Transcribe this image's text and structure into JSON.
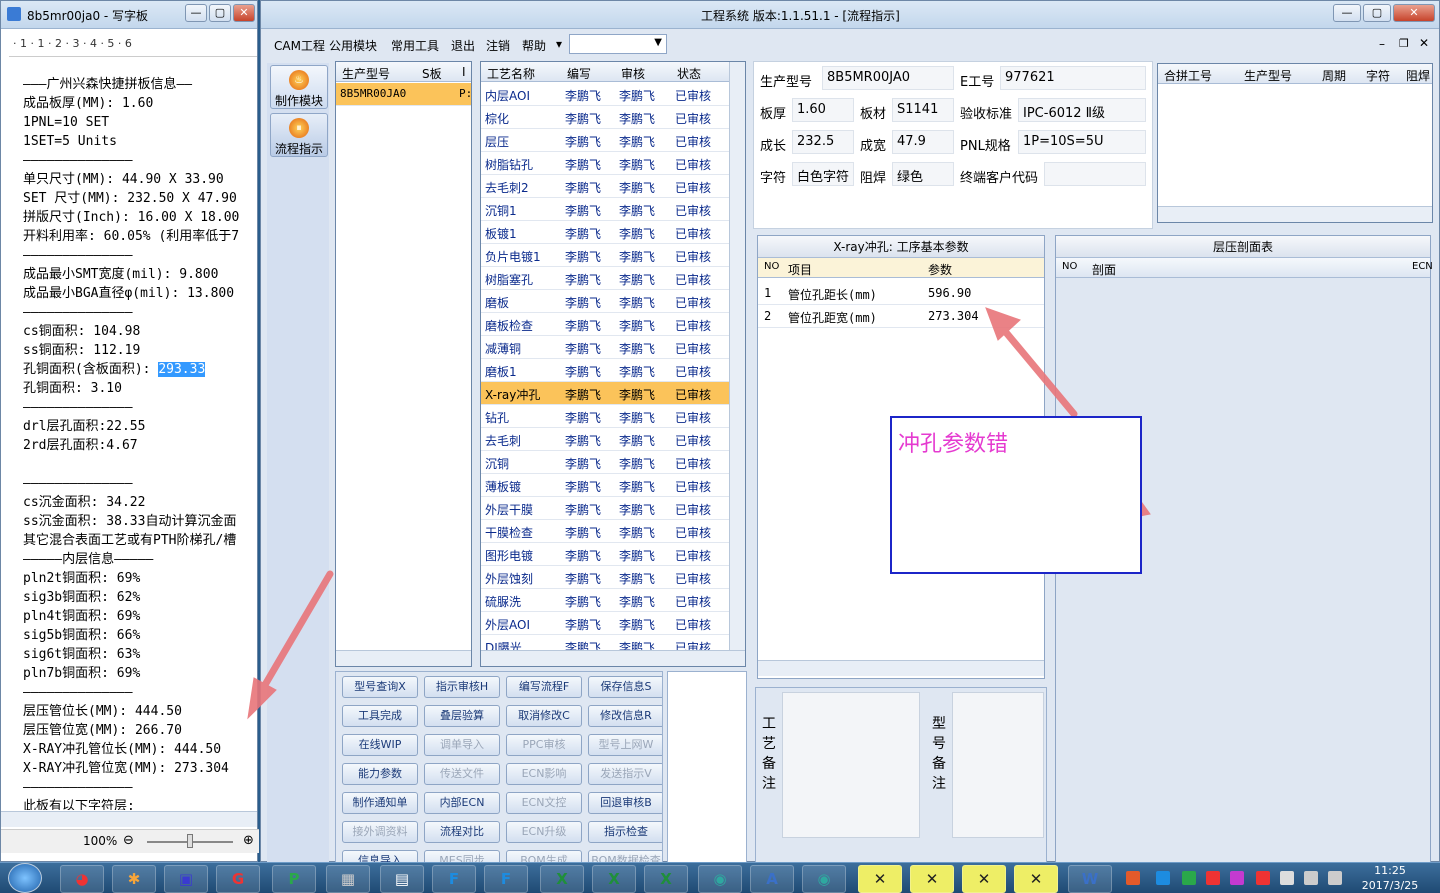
{
  "notepad": {
    "title": "8b5mr00ja0 - 写字板",
    "ruler": "· 1 · 1 · 2 · 3 · 4 · 5 · 6",
    "zoom": "100%",
    "lines": [
      "———广州兴森快捷拼板信息——",
      "成品板厚(MM): 1.60",
      "1PNL=10 SET",
      "1SET=5 Units",
      "——————————————",
      "单只尺寸(MM): 44.90 X 33.90",
      "SET 尺寸(MM): 232.50 X 47.90",
      "拼版尺寸(Inch): 16.00 X 18.00",
      "开料利用率: 60.05% (利用率低于7",
      "——————————————",
      "成品最小SMT宽度(mil): 9.800",
      "成品最小BGA直径φ(mil): 13.800",
      "——————————————",
      "cs铜面积: 104.98",
      "ss铜面积: 112.19",
      "孔铜面积(含板面积): |293.33",
      "孔铜面积: 3.10",
      "——————————————",
      "drl层孔面积:22.55",
      "2rd层孔面积:4.67",
      "",
      "——————————————",
      "cs沉金面积: 34.22",
      "ss沉金面积: 38.33自动计算沉金面",
      "其它混合表面工艺或有PTH阶梯孔/槽",
      "—————内层信息—————",
      "pln2t铜面积: 69%",
      "sig3b铜面积: 62%",
      "pln4t铜面积: 69%",
      "sig5b铜面积: 66%",
      "sig6t铜面积: 63%",
      "pln7b铜面积: 69%",
      "——————————————",
      "层压管位长(MM): 444.50",
      "层压管位宽(MM): 266.70",
      "X-RAY冲孔管位长(MM): 444.50",
      "X-RAY冲孔管位宽(MM): 273.304",
      "——————————————",
      "此板有以下字符层:"
    ]
  },
  "main": {
    "title": "工程系统  版本:1.1.51.1 - [流程指示]",
    "menu": [
      "CAM工程",
      "公用模块",
      "常用工具",
      "退出",
      "注销",
      "帮助"
    ],
    "nav": [
      {
        "label": "制作模块"
      },
      {
        "label": "流程指示"
      }
    ],
    "prod_grid": {
      "headers": [
        "生产型号",
        "S板",
        "I"
      ],
      "row": [
        "8B5MR00JA0",
        "P:"
      ]
    },
    "process_grid": {
      "headers": [
        "工艺名称",
        "编写",
        "审核",
        "状态"
      ],
      "rows": [
        [
          "内层AOI",
          "李鹏飞",
          "李鹏飞",
          "已审核"
        ],
        [
          "棕化",
          "李鹏飞",
          "李鹏飞",
          "已审核"
        ],
        [
          "层压",
          "李鹏飞",
          "李鹏飞",
          "已审核"
        ],
        [
          "树脂钻孔",
          "李鹏飞",
          "李鹏飞",
          "已审核"
        ],
        [
          "去毛刺2",
          "李鹏飞",
          "李鹏飞",
          "已审核"
        ],
        [
          "沉铜1",
          "李鹏飞",
          "李鹏飞",
          "已审核"
        ],
        [
          "板镀1",
          "李鹏飞",
          "李鹏飞",
          "已审核"
        ],
        [
          "负片电镀1",
          "李鹏飞",
          "李鹏飞",
          "已审核"
        ],
        [
          "树脂塞孔",
          "李鹏飞",
          "李鹏飞",
          "已审核"
        ],
        [
          "磨板",
          "李鹏飞",
          "李鹏飞",
          "已审核"
        ],
        [
          "磨板检查",
          "李鹏飞",
          "李鹏飞",
          "已审核"
        ],
        [
          "减薄铜",
          "李鹏飞",
          "李鹏飞",
          "已审核"
        ],
        [
          "磨板1",
          "李鹏飞",
          "李鹏飞",
          "已审核"
        ],
        [
          "X-ray冲孔",
          "李鹏飞",
          "李鹏飞",
          "已审核"
        ],
        [
          "钻孔",
          "李鹏飞",
          "李鹏飞",
          "已审核"
        ],
        [
          "去毛刺",
          "李鹏飞",
          "李鹏飞",
          "已审核"
        ],
        [
          "沉铜",
          "李鹏飞",
          "李鹏飞",
          "已审核"
        ],
        [
          "薄板镀",
          "李鹏飞",
          "李鹏飞",
          "已审核"
        ],
        [
          "外层干膜",
          "李鹏飞",
          "李鹏飞",
          "已审核"
        ],
        [
          "干膜检查",
          "李鹏飞",
          "李鹏飞",
          "已审核"
        ],
        [
          "图形电镀",
          "李鹏飞",
          "李鹏飞",
          "已审核"
        ],
        [
          "外层蚀刻",
          "李鹏飞",
          "李鹏飞",
          "已审核"
        ],
        [
          "硫脲洗",
          "李鹏飞",
          "李鹏飞",
          "已审核"
        ],
        [
          "外层AOI",
          "李鹏飞",
          "李鹏飞",
          "已审核"
        ],
        [
          "DI曝光",
          "李鹏飞",
          "李鹏飞",
          "已审核"
        ]
      ]
    },
    "buttons": [
      [
        "型号查询X",
        "指示审核H",
        "编写流程F",
        "保存信息S"
      ],
      [
        "工具完成",
        "叠层验算",
        "取消修改C",
        "修改信息R"
      ],
      [
        "在线WIP",
        "调单导入",
        "PPC审核",
        "型号上网W"
      ],
      [
        "能力参数",
        "传送文件",
        "ECN影响",
        "发送指示V"
      ],
      [
        "制作通知单",
        "内部ECN",
        "ECN文控",
        "回退审核B"
      ],
      [
        "接外调资料",
        "流程对比",
        "ECN升级",
        "指示检查"
      ],
      [
        "信息导入",
        "MES同步",
        "BOM生成",
        "BOM数据检查"
      ]
    ],
    "disabled": [
      "调单导入",
      "PPC审核",
      "型号上网W",
      "传送文件",
      "ECN影响",
      "发送指示V",
      "ECN文控",
      "接外调资料",
      "ECN升级",
      "MES同步",
      "BOM生成",
      "BOM数据检查"
    ],
    "info": {
      "model_label": "生产型号",
      "model": "8B5MR00JA0",
      "e_label": "E工号",
      "e": "977621",
      "thick_label": "板厚",
      "thick": "1.60",
      "mat_label": "板材",
      "mat": "S1141",
      "std_label": "验收标准",
      "std": "IPC-6012 Ⅱ级",
      "len_label": "成长",
      "len": "232.5",
      "wid_label": "成宽",
      "wid": "47.9",
      "pnl_label": "PNL规格",
      "pnl": "1P=10S=5U",
      "char_label": "字符",
      "char": "白色字符",
      "mask_label": "阻焊",
      "mask": "绿色",
      "cust_label": "终端客户代码",
      "cust": ""
    },
    "merge_grid": {
      "headers": [
        "合拼工号",
        "生产型号",
        "周期",
        "字符",
        "阻焊"
      ]
    },
    "param_panel": {
      "title": "X-ray冲孔: 工序基本参数",
      "headers": [
        "NO",
        "项目",
        "参数"
      ],
      "rows": [
        [
          "1",
          "管位孔距长(mm)",
          "596.90"
        ],
        [
          "2",
          "管位孔距宽(mm)",
          "273.304"
        ]
      ]
    },
    "stack_panel": {
      "title": "层压剖面表",
      "headers": [
        "NO",
        "剖面",
        "ECN"
      ]
    },
    "remark1": "工艺备注",
    "remark2": "型号备注",
    "annotation": "冲孔参数错"
  },
  "taskbar": {
    "clock_time": "11:25",
    "clock_date": "2017/3/25"
  }
}
